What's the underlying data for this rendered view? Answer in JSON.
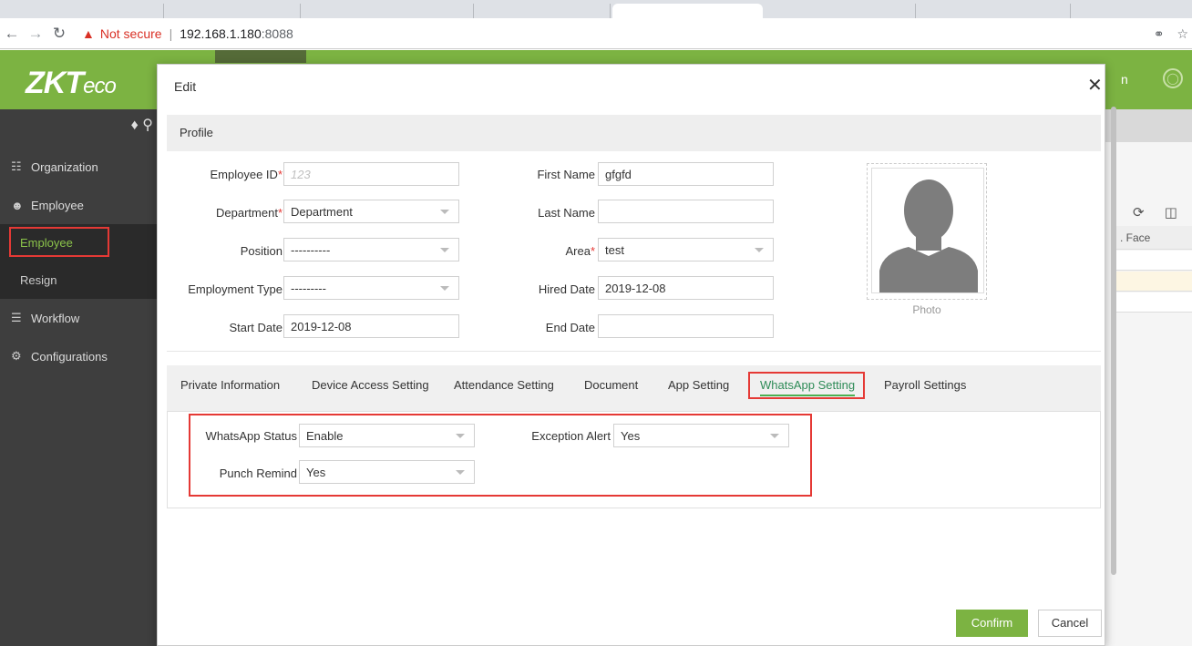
{
  "browser": {
    "not_secure": "Not secure",
    "separator": "|",
    "host": "192.168.1.180",
    "port": ":8088"
  },
  "app": {
    "logo_main": "ZKT",
    "logo_tail": "eco",
    "header_right": "n"
  },
  "sidebar": {
    "items": [
      {
        "label": "Organization",
        "icon": "sitemap-icon"
      },
      {
        "label": "Employee",
        "icon": "users-icon"
      },
      {
        "label": "Employee"
      },
      {
        "label": "Resign"
      },
      {
        "label": "Workflow",
        "icon": "list-icon"
      },
      {
        "label": "Configurations",
        "icon": "gears-icon"
      }
    ]
  },
  "background_table": {
    "face_header": ". Face"
  },
  "modal": {
    "title": "Edit",
    "profile": {
      "section_title": "Profile",
      "employee_id_label": "Employee ID",
      "employee_id_placeholder": "123",
      "first_name_label": "First Name",
      "first_name_value": "gfgfd",
      "department_label": "Department",
      "department_value": "Department",
      "last_name_label": "Last Name",
      "last_name_value": "",
      "position_label": "Position",
      "position_value": "----------",
      "area_label": "Area",
      "area_value": "test",
      "employment_type_label": "Employment Type",
      "employment_type_value": "---------",
      "hired_date_label": "Hired Date",
      "hired_date_value": "2019-12-08",
      "start_date_label": "Start Date",
      "start_date_value": "2019-12-08",
      "end_date_label": "End Date",
      "end_date_value": "",
      "photo_caption": "Photo",
      "required_mark": "*"
    },
    "tabs": [
      "Private Information",
      "Device Access Setting",
      "Attendance Setting",
      "Document",
      "App Setting",
      "WhatsApp Setting",
      "Payroll Settings"
    ],
    "active_tab": "WhatsApp Setting",
    "whatsapp": {
      "status_label": "WhatsApp Status",
      "status_value": "Enable",
      "exception_label": "Exception Alert",
      "exception_value": "Yes",
      "punch_label": "Punch Remind",
      "punch_value": "Yes"
    },
    "confirm_label": "Confirm",
    "cancel_label": "Cancel"
  },
  "colors": {
    "brand_green": "#7cb342",
    "highlight_red": "#e53935",
    "sidebar_dark": "#3e3e3e",
    "active_tab_green": "#2e8b57"
  }
}
